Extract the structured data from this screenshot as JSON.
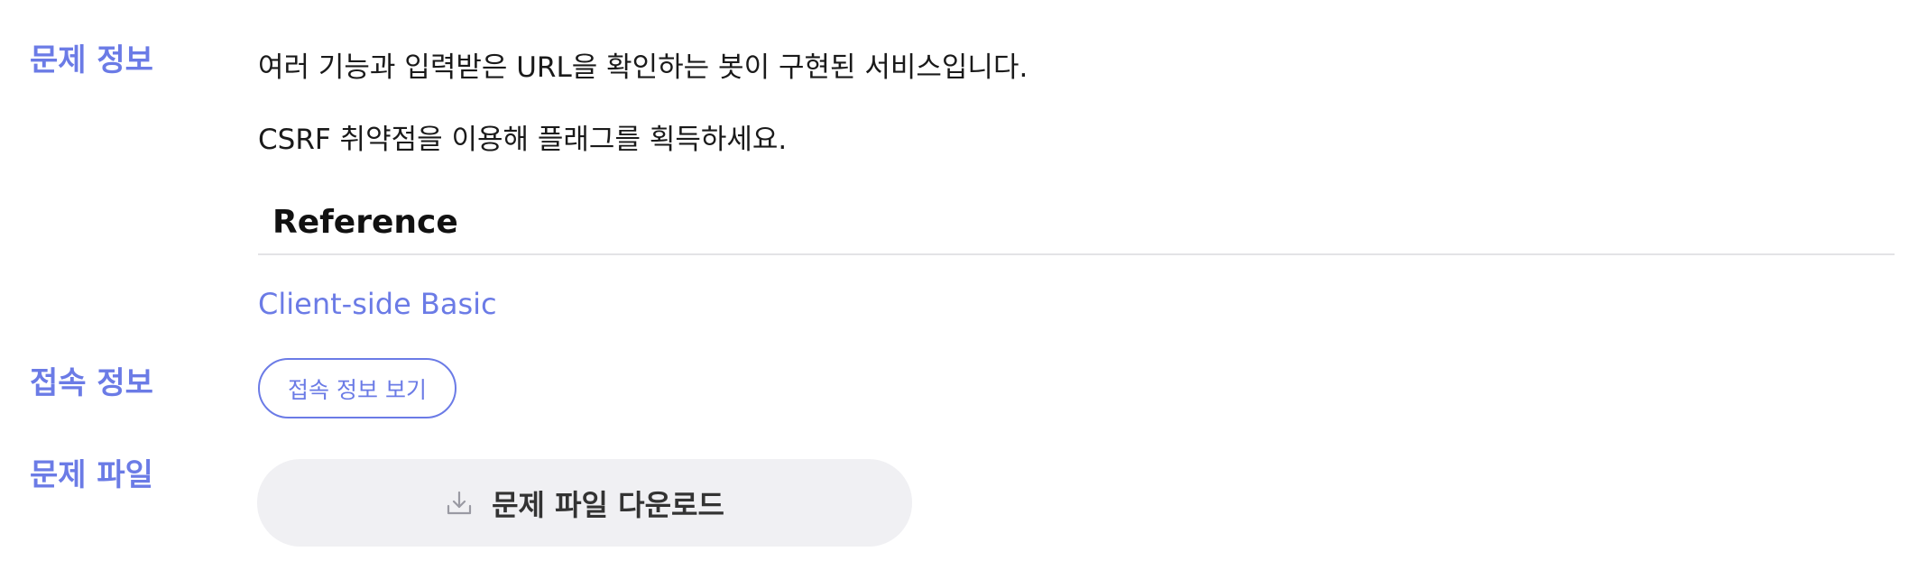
{
  "problem_info": {
    "label": "문제 정보",
    "description_line1": "여러 기능과 입력받은 URL을 확인하는 봇이 구현된 서비스입니다.",
    "description_line2": "CSRF 취약점을 이용해 플래그를 획득하세요.",
    "reference": {
      "heading": "Reference",
      "link_text": "Client-side Basic"
    }
  },
  "access_info": {
    "label": "접속 정보",
    "button_label": "접속 정보 보기"
  },
  "problem_file": {
    "label": "문제 파일",
    "download_label": "문제 파일 다운로드",
    "icon": "download-icon"
  },
  "colors": {
    "accent": "#6b7be6",
    "button_bg": "#f0f0f3",
    "divider": "#e3e3e6"
  }
}
